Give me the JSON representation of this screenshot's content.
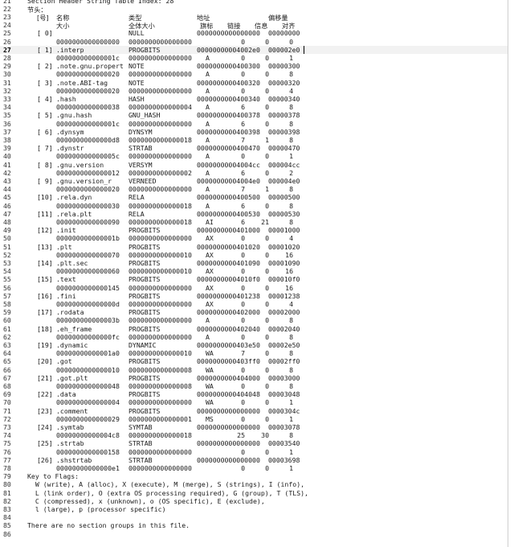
{
  "editor": {
    "first_line_text": "Section Header String Table Index: 28",
    "cursor_line": 27,
    "section_header_title": "节头：",
    "header_row1": {
      "num": "[号]",
      "name": "名称",
      "type": "类型",
      "addr": "地址",
      "offset": "偏移量"
    },
    "header_row2": {
      "size": "大小",
      "entsize": "全体大小",
      "flags": "旗标",
      "link": "链接",
      "info": "信息",
      "align": "对齐"
    },
    "sections": [
      {
        "num": "0",
        "name": "",
        "type": "NULL",
        "addr": "0000000000000000",
        "offset": "00000000",
        "size": "0000000000000000",
        "entsize": "0000000000000000",
        "flags": "",
        "link": "0",
        "info": "0",
        "align": "0"
      },
      {
        "num": "1",
        "name": ".interp",
        "type": "PROGBITS",
        "addr": "00000000004002e0",
        "offset": "000002e0",
        "size": "000000000000001c",
        "entsize": "0000000000000000",
        "flags": "A",
        "link": "0",
        "info": "0",
        "align": "1"
      },
      {
        "num": "2",
        "name": ".note.gnu.propert",
        "type": "NOTE",
        "addr": "0000000000400300",
        "offset": "00000300",
        "size": "0000000000000020",
        "entsize": "0000000000000000",
        "flags": "A",
        "link": "0",
        "info": "0",
        "align": "8"
      },
      {
        "num": "3",
        "name": ".note.ABI-tag",
        "type": "NOTE",
        "addr": "0000000000400320",
        "offset": "00000320",
        "size": "0000000000000020",
        "entsize": "0000000000000000",
        "flags": "A",
        "link": "0",
        "info": "0",
        "align": "4"
      },
      {
        "num": "4",
        "name": ".hash",
        "type": "HASH",
        "addr": "0000000000400340",
        "offset": "00000340",
        "size": "0000000000000038",
        "entsize": "0000000000000004",
        "flags": "A",
        "link": "6",
        "info": "0",
        "align": "8"
      },
      {
        "num": "5",
        "name": ".gnu.hash",
        "type": "GNU_HASH",
        "addr": "0000000000400378",
        "offset": "00000378",
        "size": "000000000000001c",
        "entsize": "0000000000000000",
        "flags": "A",
        "link": "6",
        "info": "0",
        "align": "8"
      },
      {
        "num": "6",
        "name": ".dynsym",
        "type": "DYNSYM",
        "addr": "0000000000400398",
        "offset": "00000398",
        "size": "00000000000000d8",
        "entsize": "0000000000000018",
        "flags": "A",
        "link": "7",
        "info": "1",
        "align": "8"
      },
      {
        "num": "7",
        "name": ".dynstr",
        "type": "STRTAB",
        "addr": "0000000000400470",
        "offset": "00000470",
        "size": "000000000000005c",
        "entsize": "0000000000000000",
        "flags": "A",
        "link": "0",
        "info": "0",
        "align": "1"
      },
      {
        "num": "8",
        "name": ".gnu.version",
        "type": "VERSYM",
        "addr": "00000000004004cc",
        "offset": "000004cc",
        "size": "0000000000000012",
        "entsize": "0000000000000002",
        "flags": "A",
        "link": "6",
        "info": "0",
        "align": "2"
      },
      {
        "num": "9",
        "name": ".gnu.version_r",
        "type": "VERNEED",
        "addr": "00000000004004e0",
        "offset": "000004e0",
        "size": "0000000000000020",
        "entsize": "0000000000000000",
        "flags": "A",
        "link": "7",
        "info": "1",
        "align": "8"
      },
      {
        "num": "10",
        "name": ".rela.dyn",
        "type": "RELA",
        "addr": "0000000000400500",
        "offset": "00000500",
        "size": "0000000000000030",
        "entsize": "0000000000000018",
        "flags": "A",
        "link": "6",
        "info": "0",
        "align": "8"
      },
      {
        "num": "11",
        "name": ".rela.plt",
        "type": "RELA",
        "addr": "0000000000400530",
        "offset": "00000530",
        "size": "0000000000000090",
        "entsize": "0000000000000018",
        "flags": "AI",
        "link": "6",
        "info": "21",
        "align": "8"
      },
      {
        "num": "12",
        "name": ".init",
        "type": "PROGBITS",
        "addr": "0000000000401000",
        "offset": "00001000",
        "size": "000000000000001b",
        "entsize": "0000000000000000",
        "flags": "AX",
        "link": "0",
        "info": "0",
        "align": "4"
      },
      {
        "num": "13",
        "name": ".plt",
        "type": "PROGBITS",
        "addr": "0000000000401020",
        "offset": "00001020",
        "size": "0000000000000070",
        "entsize": "0000000000000010",
        "flags": "AX",
        "link": "0",
        "info": "0",
        "align": "16"
      },
      {
        "num": "14",
        "name": ".plt.sec",
        "type": "PROGBITS",
        "addr": "0000000000401090",
        "offset": "00001090",
        "size": "0000000000000060",
        "entsize": "0000000000000010",
        "flags": "AX",
        "link": "0",
        "info": "0",
        "align": "16"
      },
      {
        "num": "15",
        "name": ".text",
        "type": "PROGBITS",
        "addr": "00000000004010f0",
        "offset": "000010f0",
        "size": "0000000000000145",
        "entsize": "0000000000000000",
        "flags": "AX",
        "link": "0",
        "info": "0",
        "align": "16"
      },
      {
        "num": "16",
        "name": ".fini",
        "type": "PROGBITS",
        "addr": "0000000000401238",
        "offset": "00001238",
        "size": "000000000000000d",
        "entsize": "0000000000000000",
        "flags": "AX",
        "link": "0",
        "info": "0",
        "align": "4"
      },
      {
        "num": "17",
        "name": ".rodata",
        "type": "PROGBITS",
        "addr": "0000000000402000",
        "offset": "00002000",
        "size": "000000000000003b",
        "entsize": "0000000000000000",
        "flags": "A",
        "link": "0",
        "info": "0",
        "align": "8"
      },
      {
        "num": "18",
        "name": ".eh_frame",
        "type": "PROGBITS",
        "addr": "0000000000402040",
        "offset": "00002040",
        "size": "00000000000000fc",
        "entsize": "0000000000000000",
        "flags": "A",
        "link": "0",
        "info": "0",
        "align": "8"
      },
      {
        "num": "19",
        "name": ".dynamic",
        "type": "DYNAMIC",
        "addr": "0000000000403e50",
        "offset": "00002e50",
        "size": "00000000000001a0",
        "entsize": "0000000000000010",
        "flags": "WA",
        "link": "7",
        "info": "0",
        "align": "8"
      },
      {
        "num": "20",
        "name": ".got",
        "type": "PROGBITS",
        "addr": "0000000000403ff0",
        "offset": "00002ff0",
        "size": "0000000000000010",
        "entsize": "0000000000000008",
        "flags": "WA",
        "link": "0",
        "info": "0",
        "align": "8"
      },
      {
        "num": "21",
        "name": ".got.plt",
        "type": "PROGBITS",
        "addr": "0000000000404000",
        "offset": "00003000",
        "size": "0000000000000048",
        "entsize": "0000000000000008",
        "flags": "WA",
        "link": "0",
        "info": "0",
        "align": "8"
      },
      {
        "num": "22",
        "name": ".data",
        "type": "PROGBITS",
        "addr": "0000000000404048",
        "offset": "00003048",
        "size": "0000000000000004",
        "entsize": "0000000000000000",
        "flags": "WA",
        "link": "0",
        "info": "0",
        "align": "1"
      },
      {
        "num": "23",
        "name": ".comment",
        "type": "PROGBITS",
        "addr": "0000000000000000",
        "offset": "0000304c",
        "size": "0000000000000029",
        "entsize": "0000000000000001",
        "flags": "MS",
        "link": "0",
        "info": "0",
        "align": "1"
      },
      {
        "num": "24",
        "name": ".symtab",
        "type": "SYMTAB",
        "addr": "0000000000000000",
        "offset": "00003078",
        "size": "00000000000004c8",
        "entsize": "0000000000000018",
        "flags": "",
        "link": "25",
        "info": "30",
        "align": "8"
      },
      {
        "num": "25",
        "name": ".strtab",
        "type": "STRTAB",
        "addr": "0000000000000000",
        "offset": "00003540",
        "size": "0000000000000158",
        "entsize": "0000000000000000",
        "flags": "",
        "link": "0",
        "info": "0",
        "align": "1"
      },
      {
        "num": "26",
        "name": ".shstrtab",
        "type": "STRTAB",
        "addr": "0000000000000000",
        "offset": "00003698",
        "size": "00000000000000e1",
        "entsize": "0000000000000000",
        "flags": "",
        "link": "0",
        "info": "0",
        "align": "1"
      }
    ],
    "key_to_flags": [
      "Key to Flags:",
      "  W (write), A (alloc), X (execute), M (merge), S (strings), I (info),",
      "  L (link order), O (extra OS processing required), G (group), T (TLS),",
      "  C (compressed), x (unknown), o (OS specific), E (exclude),",
      "  l (large), p (processor specific)"
    ],
    "no_groups_text": "There are no section groups in this file."
  }
}
